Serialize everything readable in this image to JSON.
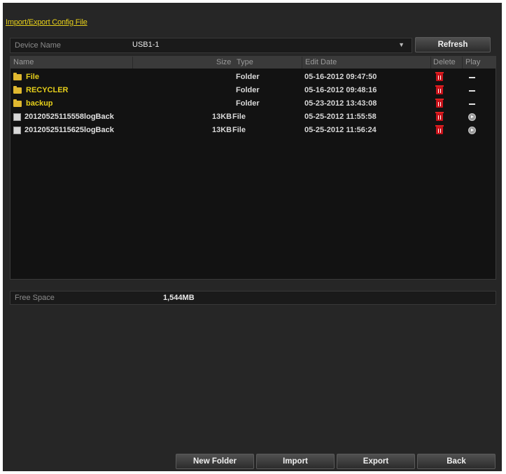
{
  "title": "Import/Export Config File",
  "device": {
    "label": "Device Name",
    "value": "USB1-1",
    "refresh_label": "Refresh"
  },
  "table": {
    "columns": [
      "Name",
      "Size",
      "Type",
      "Edit Date",
      "Delete",
      "Play"
    ],
    "rows": [
      {
        "name": "File",
        "size": "",
        "type": "Folder",
        "date": "05-16-2012 09:47:50",
        "kind": "folder",
        "play": "dash"
      },
      {
        "name": "RECYCLER",
        "size": "",
        "type": "Folder",
        "date": "05-16-2012 09:48:16",
        "kind": "folder",
        "play": "dash"
      },
      {
        "name": "backup",
        "size": "",
        "type": "Folder",
        "date": "05-23-2012 13:43:08",
        "kind": "folder",
        "play": "dash"
      },
      {
        "name": "20120525115558logBack",
        "size": "13KB",
        "type": "File",
        "date": "05-25-2012 11:55:58",
        "kind": "file",
        "play": "play"
      },
      {
        "name": "20120525115625logBack",
        "size": "13KB",
        "type": "File",
        "date": "05-25-2012 11:56:24",
        "kind": "file",
        "play": "play"
      }
    ]
  },
  "free_space": {
    "label": "Free Space",
    "value": "1,544MB"
  },
  "buttons": {
    "new_folder": "New Folder",
    "import": "Import",
    "export": "Export",
    "back": "Back"
  },
  "colors": {
    "accent": "#e6cf1a",
    "delete": "#c8121a"
  }
}
